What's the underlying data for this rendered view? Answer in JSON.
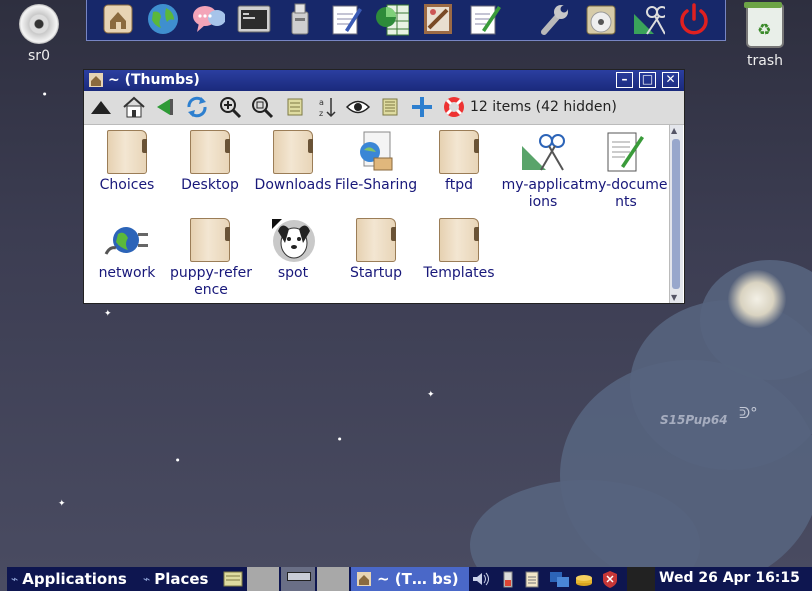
{
  "desktop": {
    "drive_label": "sr0",
    "trash_label": "trash",
    "brand_text": "S15Pup64"
  },
  "tray": {
    "icons": [
      "home-icon",
      "globe-icon",
      "chat-icon",
      "terminal-icon",
      "usb-drive-icon",
      "text-editor-icon",
      "spreadsheet-icon",
      "paint-icon",
      "notepad-icon",
      "wrench-icon",
      "disc-burner-icon",
      "geometry-icon",
      "power-icon"
    ]
  },
  "window": {
    "title": "~ (Thumbs)",
    "item_count": "12 items (42 hidden)",
    "toolbar": [
      "up-arrow-icon",
      "home-icon",
      "back-icon",
      "refresh-icon",
      "zoom-in-icon",
      "zoom-fit-icon",
      "list-view-icon",
      "sort-icon",
      "eye-icon",
      "details-icon",
      "new-icon",
      "help-icon"
    ],
    "items": [
      {
        "label": "Choices",
        "icon": "folder-icon"
      },
      {
        "label": "Desktop",
        "icon": "folder-icon"
      },
      {
        "label": "Downloads",
        "icon": "folder-icon"
      },
      {
        "label": "File-Sharing",
        "icon": "file-sharing-icon"
      },
      {
        "label": "ftpd",
        "icon": "folder-icon"
      },
      {
        "label": "my-applications",
        "icon": "applications-icon"
      },
      {
        "label": "my-documents",
        "icon": "documents-icon"
      },
      {
        "label": "network",
        "icon": "network-plug-icon"
      },
      {
        "label": "puppy-reference",
        "icon": "folder-icon"
      },
      {
        "label": "spot",
        "icon": "puppy-icon"
      },
      {
        "label": "Startup",
        "icon": "folder-icon"
      },
      {
        "label": "Templates",
        "icon": "folder-icon"
      }
    ]
  },
  "taskbar": {
    "applications_label": "Applications",
    "places_label": "Places",
    "task_label": "~ (T… bs)",
    "clock": "Wed 26 Apr 16:15"
  },
  "colors": {
    "window_title": "#1f318c",
    "tray": "#17286a",
    "taskbar": "#0e1650",
    "active_task": "#4a68c8",
    "file_label": "#18187a"
  }
}
